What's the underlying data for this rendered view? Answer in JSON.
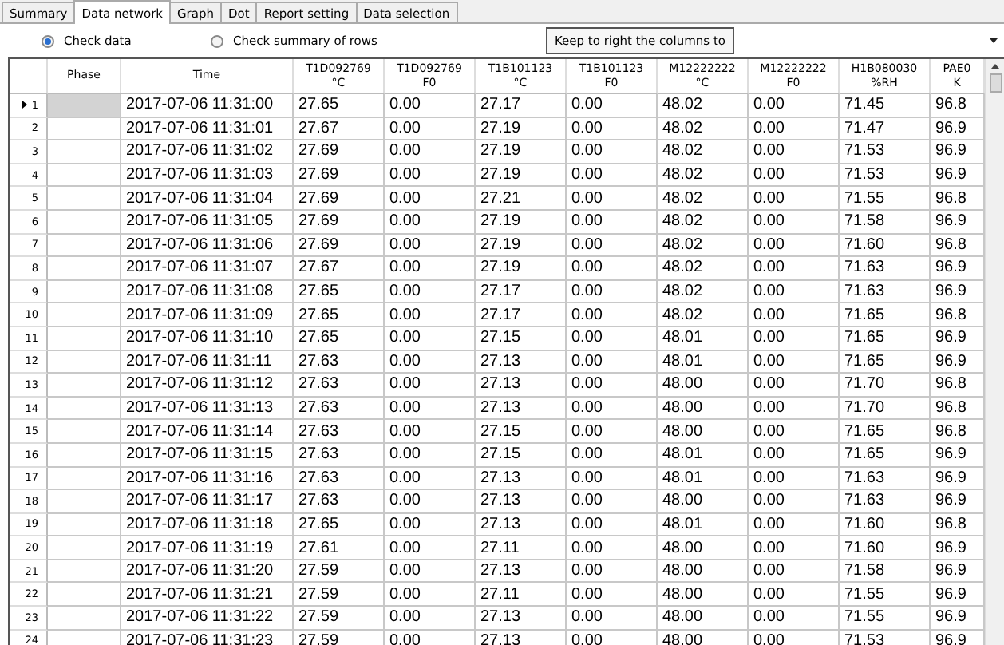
{
  "tabs": [
    {
      "label": "Summary",
      "selected": false
    },
    {
      "label": "Data network",
      "selected": true
    },
    {
      "label": "Graph",
      "selected": false
    },
    {
      "label": "Dot",
      "selected": false
    },
    {
      "label": "Report setting",
      "selected": false
    },
    {
      "label": "Data selection",
      "selected": false
    }
  ],
  "view_options": [
    {
      "label": "Check data",
      "selected": true
    },
    {
      "label": "Check summary of rows",
      "selected": false
    }
  ],
  "keep_button": "Keep to right the columns to",
  "table": {
    "columns": [
      {
        "line1": "Phase"
      },
      {
        "line1": "Time"
      },
      {
        "line1": "T1D092769",
        "line2": "°C"
      },
      {
        "line1": "T1D092769",
        "line2": "F0"
      },
      {
        "line1": "T1B101123",
        "line2": "°C"
      },
      {
        "line1": "T1B101123",
        "line2": "F0"
      },
      {
        "line1": "M12222222",
        "line2": "°C"
      },
      {
        "line1": "M12222222",
        "line2": "F0"
      },
      {
        "line1": "H1B080030",
        "line2": "%RH"
      },
      {
        "line1": "PAE0",
        "line2": "K"
      }
    ],
    "rows": [
      {
        "number": "1",
        "selected": true,
        "cells": [
          "",
          "2017-07-06 11:31:00",
          "27.65",
          "0.00",
          "27.17",
          "0.00",
          "48.02",
          "0.00",
          "71.45",
          "96.8"
        ]
      },
      {
        "number": "2",
        "selected": false,
        "cells": [
          "",
          "2017-07-06 11:31:01",
          "27.67",
          "0.00",
          "27.19",
          "0.00",
          "48.02",
          "0.00",
          "71.47",
          "96.9"
        ]
      },
      {
        "number": "3",
        "selected": false,
        "cells": [
          "",
          "2017-07-06 11:31:02",
          "27.69",
          "0.00",
          "27.19",
          "0.00",
          "48.02",
          "0.00",
          "71.53",
          "96.9"
        ]
      },
      {
        "number": "4",
        "selected": false,
        "cells": [
          "",
          "2017-07-06 11:31:03",
          "27.69",
          "0.00",
          "27.19",
          "0.00",
          "48.02",
          "0.00",
          "71.53",
          "96.9"
        ]
      },
      {
        "number": "5",
        "selected": false,
        "cells": [
          "",
          "2017-07-06 11:31:04",
          "27.69",
          "0.00",
          "27.21",
          "0.00",
          "48.02",
          "0.00",
          "71.55",
          "96.8"
        ]
      },
      {
        "number": "6",
        "selected": false,
        "cells": [
          "",
          "2017-07-06 11:31:05",
          "27.69",
          "0.00",
          "27.19",
          "0.00",
          "48.02",
          "0.00",
          "71.58",
          "96.9"
        ]
      },
      {
        "number": "7",
        "selected": false,
        "cells": [
          "",
          "2017-07-06 11:31:06",
          "27.69",
          "0.00",
          "27.19",
          "0.00",
          "48.02",
          "0.00",
          "71.60",
          "96.8"
        ]
      },
      {
        "number": "8",
        "selected": false,
        "cells": [
          "",
          "2017-07-06 11:31:07",
          "27.67",
          "0.00",
          "27.19",
          "0.00",
          "48.02",
          "0.00",
          "71.63",
          "96.9"
        ]
      },
      {
        "number": "9",
        "selected": false,
        "cells": [
          "",
          "2017-07-06 11:31:08",
          "27.65",
          "0.00",
          "27.17",
          "0.00",
          "48.02",
          "0.00",
          "71.63",
          "96.9"
        ]
      },
      {
        "number": "10",
        "selected": false,
        "cells": [
          "",
          "2017-07-06 11:31:09",
          "27.65",
          "0.00",
          "27.17",
          "0.00",
          "48.02",
          "0.00",
          "71.65",
          "96.8"
        ]
      },
      {
        "number": "11",
        "selected": false,
        "cells": [
          "",
          "2017-07-06 11:31:10",
          "27.65",
          "0.00",
          "27.15",
          "0.00",
          "48.01",
          "0.00",
          "71.65",
          "96.9"
        ]
      },
      {
        "number": "12",
        "selected": false,
        "cells": [
          "",
          "2017-07-06 11:31:11",
          "27.63",
          "0.00",
          "27.13",
          "0.00",
          "48.01",
          "0.00",
          "71.65",
          "96.9"
        ]
      },
      {
        "number": "13",
        "selected": false,
        "cells": [
          "",
          "2017-07-06 11:31:12",
          "27.63",
          "0.00",
          "27.13",
          "0.00",
          "48.00",
          "0.00",
          "71.70",
          "96.8"
        ]
      },
      {
        "number": "14",
        "selected": false,
        "cells": [
          "",
          "2017-07-06 11:31:13",
          "27.63",
          "0.00",
          "27.13",
          "0.00",
          "48.00",
          "0.00",
          "71.70",
          "96.8"
        ]
      },
      {
        "number": "15",
        "selected": false,
        "cells": [
          "",
          "2017-07-06 11:31:14",
          "27.63",
          "0.00",
          "27.15",
          "0.00",
          "48.00",
          "0.00",
          "71.65",
          "96.8"
        ]
      },
      {
        "number": "16",
        "selected": false,
        "cells": [
          "",
          "2017-07-06 11:31:15",
          "27.63",
          "0.00",
          "27.15",
          "0.00",
          "48.01",
          "0.00",
          "71.65",
          "96.9"
        ]
      },
      {
        "number": "17",
        "selected": false,
        "cells": [
          "",
          "2017-07-06 11:31:16",
          "27.63",
          "0.00",
          "27.13",
          "0.00",
          "48.01",
          "0.00",
          "71.63",
          "96.9"
        ]
      },
      {
        "number": "18",
        "selected": false,
        "cells": [
          "",
          "2017-07-06 11:31:17",
          "27.63",
          "0.00",
          "27.13",
          "0.00",
          "48.00",
          "0.00",
          "71.63",
          "96.9"
        ]
      },
      {
        "number": "19",
        "selected": false,
        "cells": [
          "",
          "2017-07-06 11:31:18",
          "27.65",
          "0.00",
          "27.13",
          "0.00",
          "48.01",
          "0.00",
          "71.60",
          "96.8"
        ]
      },
      {
        "number": "20",
        "selected": false,
        "cells": [
          "",
          "2017-07-06 11:31:19",
          "27.61",
          "0.00",
          "27.11",
          "0.00",
          "48.00",
          "0.00",
          "71.60",
          "96.9"
        ]
      },
      {
        "number": "21",
        "selected": false,
        "cells": [
          "",
          "2017-07-06 11:31:20",
          "27.59",
          "0.00",
          "27.13",
          "0.00",
          "48.00",
          "0.00",
          "71.58",
          "96.9"
        ]
      },
      {
        "number": "22",
        "selected": false,
        "cells": [
          "",
          "2017-07-06 11:31:21",
          "27.59",
          "0.00",
          "27.11",
          "0.00",
          "48.00",
          "0.00",
          "71.55",
          "96.9"
        ]
      },
      {
        "number": "23",
        "selected": false,
        "cells": [
          "",
          "2017-07-06 11:31:22",
          "27.59",
          "0.00",
          "27.13",
          "0.00",
          "48.00",
          "0.00",
          "71.55",
          "96.9"
        ]
      },
      {
        "number": "24",
        "selected": false,
        "cells": [
          "",
          "2017-07-06 11:31:23",
          "27.59",
          "0.00",
          "27.13",
          "0.00",
          "48.00",
          "0.00",
          "71.53",
          "96.9"
        ]
      }
    ]
  }
}
